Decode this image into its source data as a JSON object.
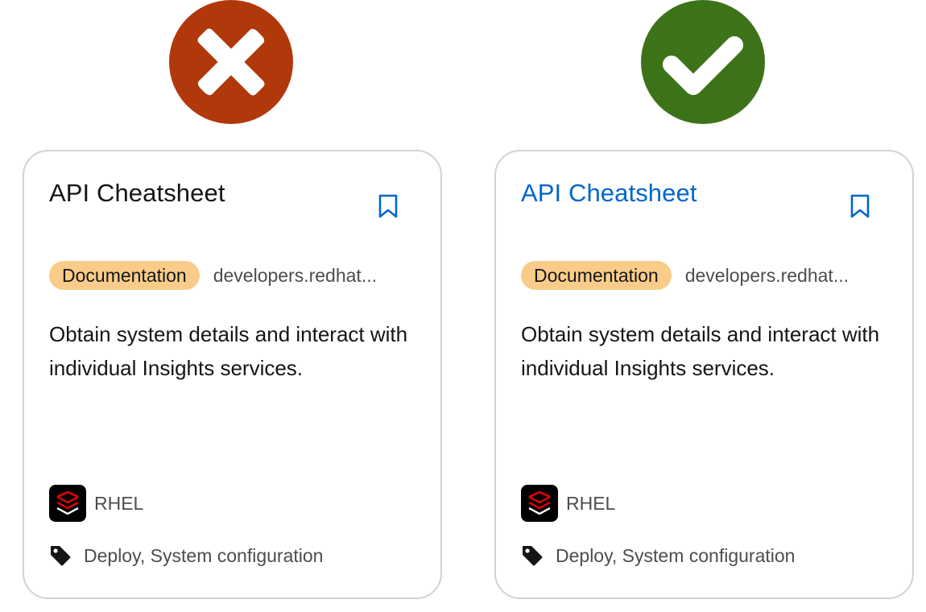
{
  "colors": {
    "bad": "#b1380b",
    "good": "#3d7318",
    "link": "#0066cc",
    "badge_bg": "#f9cc8a",
    "card_border": "#d2d2d2"
  },
  "status_icons": {
    "bad": "close-icon",
    "good": "checkmark-icon"
  },
  "cards": [
    {
      "variant": "incorrect",
      "title": "API Cheatsheet",
      "badge": "Documentation",
      "source": "developers.redhat...",
      "description": "Obtain system details and interact with individual Insights services.",
      "product": "RHEL",
      "tags": "Deploy, System configuration"
    },
    {
      "variant": "correct",
      "title": "API Cheatsheet",
      "badge": "Documentation",
      "source": "developers.redhat...",
      "description": "Obtain system details and interact with individual Insights services.",
      "product": "RHEL",
      "tags": "Deploy, System configuration"
    }
  ]
}
